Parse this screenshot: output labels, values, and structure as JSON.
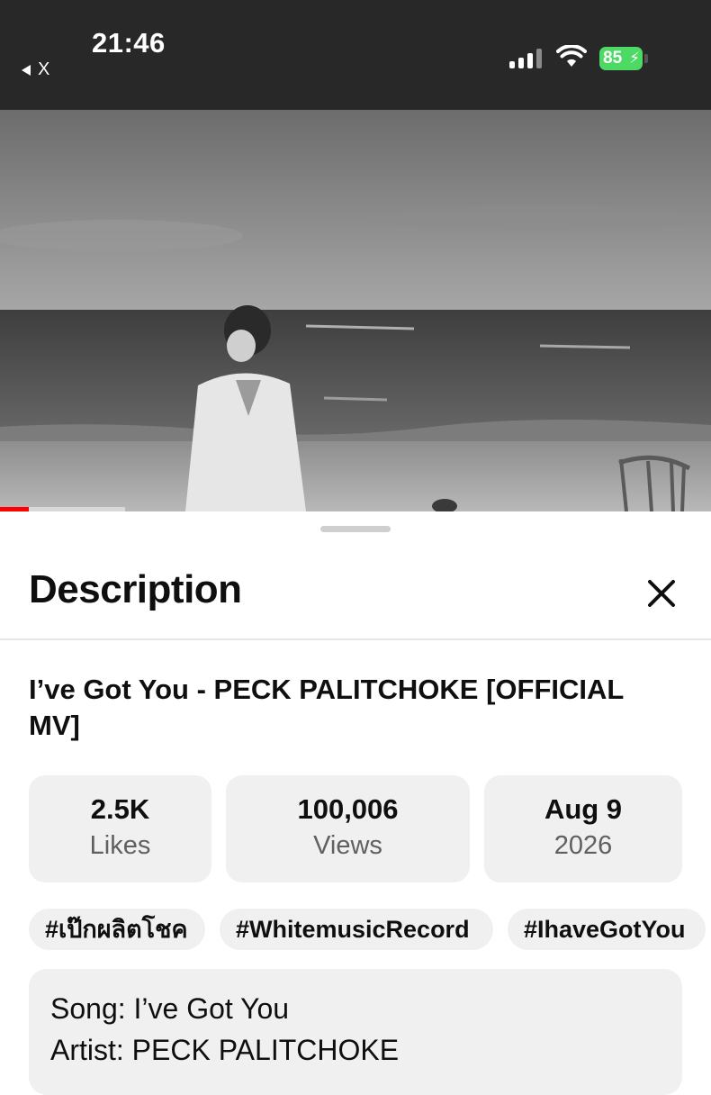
{
  "status_bar": {
    "time": "21:46",
    "back_label": "X",
    "battery": "85"
  },
  "description_sheet": {
    "title": "Description",
    "video_title": "I’ve Got You - PECK PALITCHOKE [OFFICIAL MV]",
    "stats": {
      "likes": {
        "value": "2.5K",
        "label": "Likes"
      },
      "views": {
        "value": "100,006",
        "label": "Views"
      },
      "date": {
        "value": "Aug 9",
        "label": "2026"
      }
    },
    "hashtags": [
      "#เป๊กผลิตโชค",
      "#WhitemusicRecord",
      "#IhaveGotYou"
    ],
    "description_lines": [
      "Song: I’ve Got You",
      "Artist: PECK PALITCHOKE"
    ]
  },
  "player": {
    "progress_fraction": 0.04,
    "buffer_fraction": 0.175,
    "accent_color": "#ff0000"
  },
  "icons": [
    "signal-icon",
    "wifi-icon",
    "battery-icon",
    "close-icon"
  ]
}
